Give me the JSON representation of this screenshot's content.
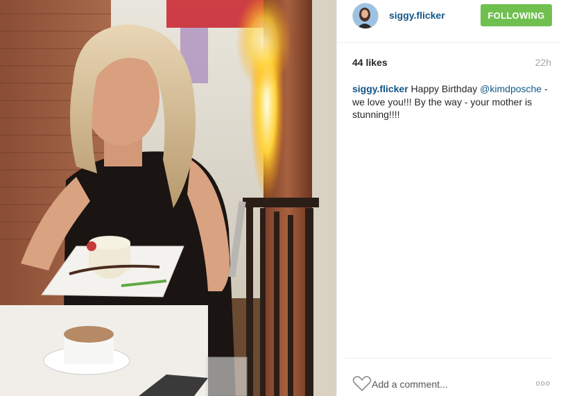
{
  "post": {
    "photo_alt": "",
    "user": {
      "username": "siggy.flicker",
      "avatar_icon": "avatar-image"
    },
    "follow_button": {
      "label": "FOLLOWING",
      "color": "#70c050"
    },
    "likes": "44 likes",
    "timestamp": "22h",
    "caption": {
      "username": "siggy.flicker",
      "text_before": " Happy Birthday ",
      "mention": "@kimdposche",
      "text_after": " - we love you!!! By the way - your mother is stunning!!!!"
    },
    "comment": {
      "placeholder": "Add a comment...",
      "heart_icon": "heart-outline-icon",
      "more_icon": "ellipsis-icon",
      "more_label": "ooo"
    },
    "colors": {
      "link": "#125688",
      "text": "#262626",
      "muted": "#a5a7aa",
      "divider": "#efefef"
    }
  }
}
